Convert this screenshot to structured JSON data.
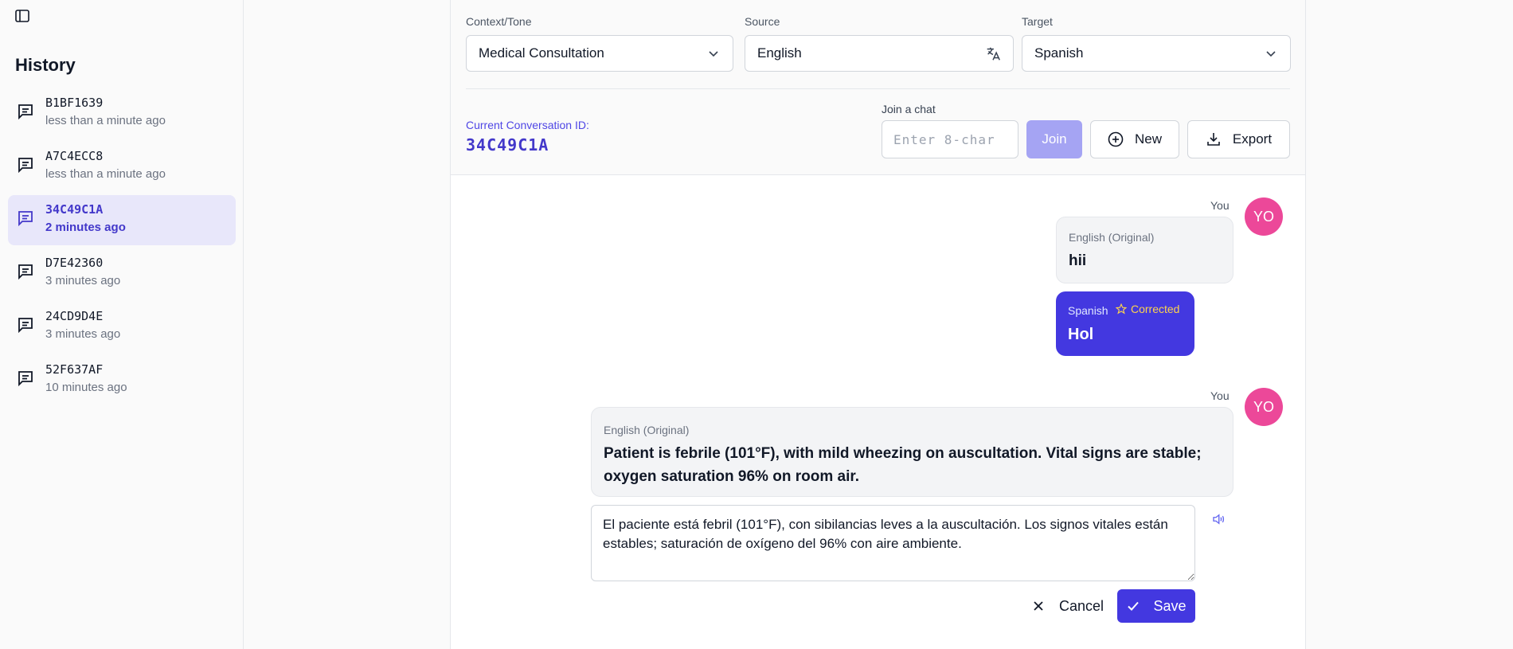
{
  "sidebar": {
    "title": "History",
    "items": [
      {
        "id": "B1BF1639",
        "time": "less than a minute ago",
        "active": false
      },
      {
        "id": "A7C4ECC8",
        "time": "less than a minute ago",
        "active": false
      },
      {
        "id": "34C49C1A",
        "time": "2 minutes ago",
        "active": true
      },
      {
        "id": "D7E42360",
        "time": "3 minutes ago",
        "active": false
      },
      {
        "id": "24CD9D4E",
        "time": "3 minutes ago",
        "active": false
      },
      {
        "id": "52F637AF",
        "time": "10 minutes ago",
        "active": false
      }
    ]
  },
  "header": {
    "context": {
      "label": "Context/Tone",
      "value": "Medical Consultation"
    },
    "source": {
      "label": "Source",
      "value": "English"
    },
    "target": {
      "label": "Target",
      "value": "Spanish"
    },
    "conversation": {
      "label": "Current Conversation ID:",
      "id": "34C49C1A"
    },
    "join": {
      "label": "Join a chat",
      "placeholder": "Enter 8-char",
      "button": "Join"
    },
    "new_button": "New",
    "export_button": "Export"
  },
  "messages": [
    {
      "sender": "You",
      "avatar": "YO",
      "original_label": "English (Original)",
      "original_text": "hii",
      "translation_label": "Spanish",
      "corrected_label": "Corrected",
      "translation_text": "Hol"
    },
    {
      "sender": "You",
      "avatar": "YO",
      "original_label": "English (Original)",
      "original_text_line1": "Patient is febrile (101°F), with mild wheezing on auscultation. Vital signs are stable;",
      "original_text_line2": "oxygen saturation 96% on room air.",
      "edit_text": "El paciente está febril (101°F), con sibilancias leves a la auscultación. Los signos vitales están estables; saturación de oxígeno del 96% con aire ambiente.",
      "cancel_label": "Cancel",
      "save_label": "Save"
    }
  ],
  "colors": {
    "accent": "#4338e0",
    "avatar": "#ec4899",
    "active_item_bg": "#e8e7fa",
    "corrected": "#fcd34d"
  }
}
